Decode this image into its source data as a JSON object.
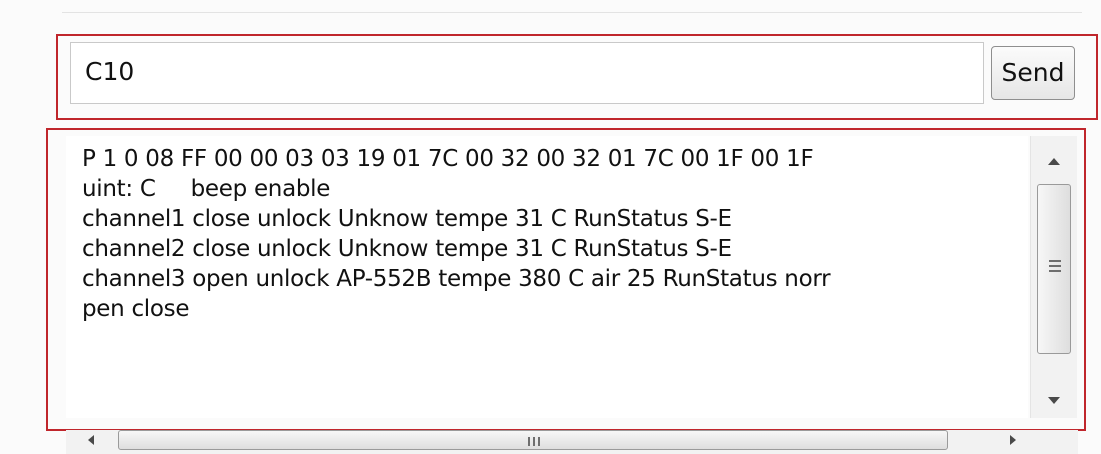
{
  "command": {
    "input_value": "C10",
    "send_label": "Send"
  },
  "output": {
    "lines": [
      "P 1 0 08 FF 00 00 03 03 19 01 7C 00 32 00 32 01 7C 00 1F 00 1F",
      "uint: C     beep enable",
      "channel1 close unlock Unknow tempe 31 C RunStatus S-E",
      "channel2 close unlock Unknow tempe 31 C RunStatus S-E",
      "channel3 open unlock AP-552B tempe 380 C air 25 RunStatus norr",
      "pen close"
    ]
  },
  "scrollbars": {
    "vertical_icons": [
      "scroll-up-arrow-icon",
      "scroll-down-arrow-icon",
      "grip-icon"
    ],
    "horizontal_icons": [
      "scroll-left-arrow-icon",
      "scroll-right-arrow-icon",
      "grip-icon"
    ]
  },
  "colors": {
    "highlight_border": "#c0262c",
    "background": "#fbfbfb"
  }
}
